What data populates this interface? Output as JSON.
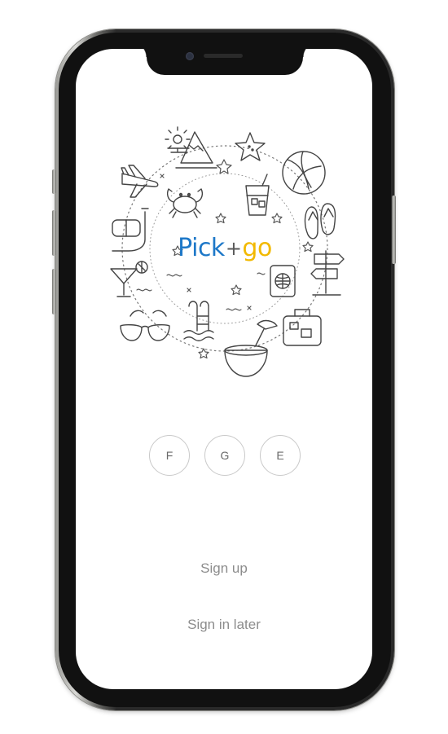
{
  "app": {
    "logo": {
      "pick": "Pick",
      "plus": "+",
      "go": "go"
    },
    "colors": {
      "pick": "#1e78c8",
      "go": "#f2b900",
      "text_muted": "#8c8c8c",
      "icon_stroke": "#444444"
    }
  },
  "social": [
    {
      "label": "F"
    },
    {
      "label": "G"
    },
    {
      "label": "E"
    }
  ],
  "links": {
    "sign_up": "Sign up",
    "sign_in_later": "Sign in later"
  },
  "illustration_icons": [
    "sun-icon",
    "mountain-icon",
    "starfish-icon",
    "airplane-icon",
    "crab-icon",
    "cocktail-glass-icon",
    "beach-ball-icon",
    "snorkel-mask-icon",
    "flip-flops-icon",
    "passport-icon",
    "signpost-icon",
    "martini-icon",
    "sunglasses-icon",
    "pool-ladder-icon",
    "coconut-drink-icon",
    "suitcase-icon"
  ]
}
